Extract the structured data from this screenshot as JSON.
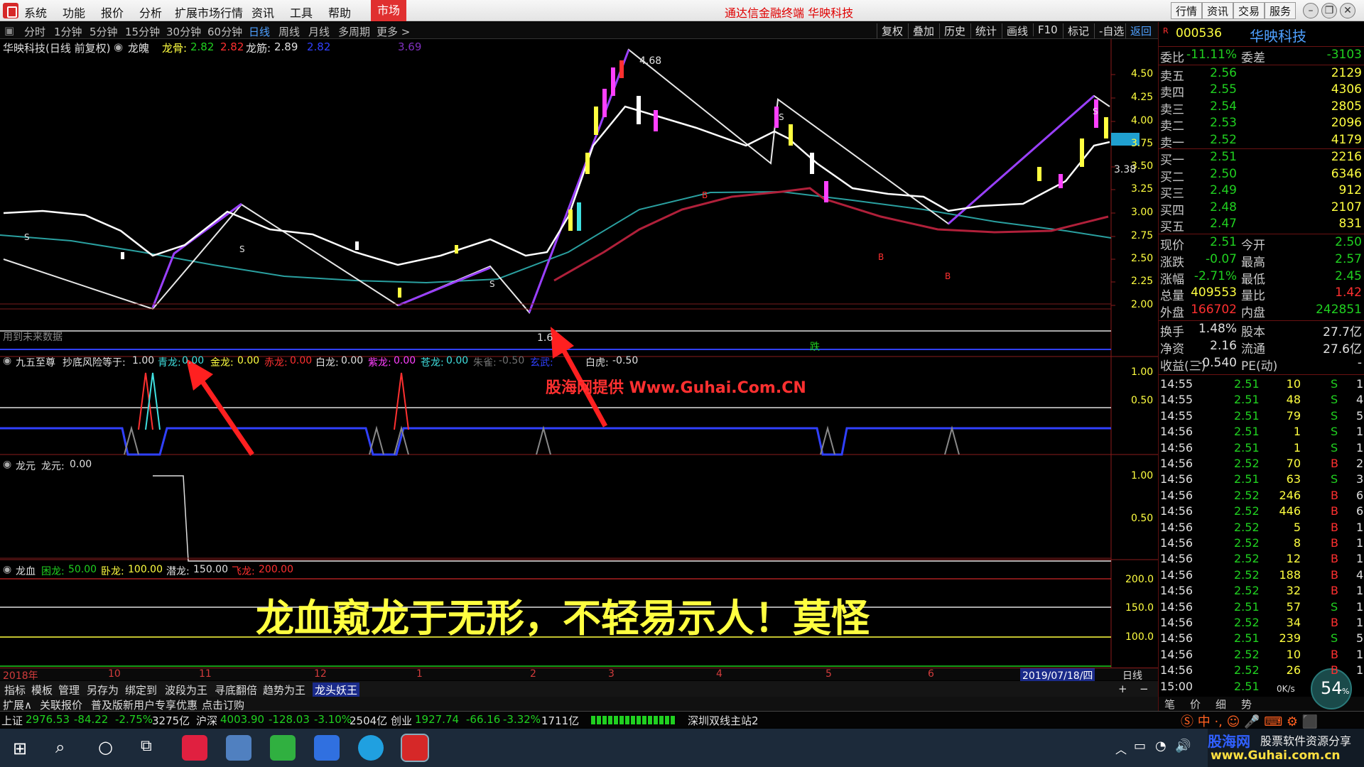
{
  "menu": {
    "items": [
      "系统",
      "功能",
      "报价",
      "分析",
      "扩展市场行情",
      "资讯",
      "工具",
      "帮助"
    ],
    "market_tab": "市场",
    "app_title": "通达信金融终端 华映科技",
    "right_buttons": [
      "行情",
      "资讯",
      "交易",
      "服务"
    ]
  },
  "toolbar": {
    "periods": [
      "分时",
      "1分钟",
      "5分钟",
      "15分钟",
      "30分钟",
      "60分钟",
      "日线",
      "周线",
      "月线",
      "多周期",
      "更多 >"
    ],
    "active_period": "日线",
    "buttons": [
      "复权",
      "叠加",
      "历史",
      "统计",
      "画线",
      "F10",
      "标记",
      "-自选",
      "返回"
    ]
  },
  "main_chart": {
    "header_stock": "华映科技(日线 前复权)",
    "indicator": "龙魄",
    "longgu_label": "龙骨:",
    "longgu_values": [
      "2.82",
      "2.82"
    ],
    "longjin_label": "龙筋:",
    "longjin_values": [
      "2.89",
      "2.82",
      "3.69"
    ],
    "price_ticks": [
      "4.50",
      "4.25",
      "4.00",
      "3.75",
      "3.50",
      "3.25",
      "3.00",
      "2.75",
      "2.50",
      "2.25",
      "2.00"
    ],
    "current_price_tag": "3.38",
    "high_label": "4.68",
    "low_label": "1.6",
    "future_note": "用到未来数据",
    "die_label": "跌",
    "s_marks": [
      "S",
      "S",
      "S",
      "S",
      "S"
    ],
    "b_marks": [
      "B",
      "B",
      "B"
    ]
  },
  "panel_jiuwu": {
    "name": "九五至尊",
    "items": [
      {
        "label": "抄底风险等于:",
        "value": "1.00",
        "color": "#e0e0e0"
      },
      {
        "label": "青龙:",
        "value": "0.00",
        "color": "#40e0e0"
      },
      {
        "label": "金龙:",
        "value": "0.00",
        "color": "#ffff40"
      },
      {
        "label": "赤龙:",
        "value": "0.00",
        "color": "#ff3030"
      },
      {
        "label": "白龙:",
        "value": "0.00",
        "color": "#e0e0e0"
      },
      {
        "label": "紫龙:",
        "value": "0.00",
        "color": "#ff40ff"
      },
      {
        "label": "苍龙:",
        "value": "0.00",
        "color": "#40e0e0"
      },
      {
        "label": "朱雀:",
        "value": "-0.50",
        "color": "#707070"
      },
      {
        "label": "玄武:",
        "value": "",
        "color": "#3040ff"
      },
      {
        "label": "白虎:",
        "value": "-0.50",
        "color": "#e0e0e0"
      }
    ],
    "ticks": [
      "1.00",
      "0.50"
    ],
    "watermark": "股海网提供 Www.Guhai.Com.CN"
  },
  "panel_longyuan": {
    "name": "龙元",
    "label": "龙元:",
    "value": "0.00",
    "ticks": [
      "1.00",
      "0.50"
    ]
  },
  "panel_longxue": {
    "name": "龙血",
    "items": [
      {
        "label": "困龙:",
        "value": "50.00",
        "color": "#20d020"
      },
      {
        "label": "卧龙:",
        "value": "100.00",
        "color": "#ffff40"
      },
      {
        "label": "潜龙:",
        "value": "150.00",
        "color": "#e0e0e0"
      },
      {
        "label": "飞龙:",
        "value": "200.00",
        "color": "#ff3030"
      }
    ],
    "ticks": [
      "200.0",
      "150.0",
      "100.0"
    ],
    "caption": "龙血窥龙于无形，不轻易示人！莫怪"
  },
  "date_axis": {
    "labels": [
      "2018年",
      "10",
      "11",
      "12",
      "1",
      "2",
      "3",
      "4",
      "5",
      "6"
    ],
    "current_date": "2019/07/18/四",
    "period": "日线"
  },
  "bottom_tabs": [
    "指标",
    "模板",
    "管理",
    "另存为",
    "绑定到",
    "波段为王",
    "寻底翻倍",
    "趋势为王",
    "龙头妖王"
  ],
  "bottom_tabs2": [
    "扩展∧",
    "关联报价",
    "普及版新用户专享优惠",
    "点击订购"
  ],
  "quote": {
    "code": "000536",
    "name": "华映科技",
    "weibi": {
      "label": "委比",
      "value": "-11.11%",
      "label2": "委差",
      "value2": "-3103"
    },
    "sells": [
      {
        "label": "卖五",
        "price": "2.56",
        "vol": "2129"
      },
      {
        "label": "卖四",
        "price": "2.55",
        "vol": "4306"
      },
      {
        "label": "卖三",
        "price": "2.54",
        "vol": "2805"
      },
      {
        "label": "卖二",
        "price": "2.53",
        "vol": "2096"
      },
      {
        "label": "卖一",
        "price": "2.52",
        "vol": "4179"
      }
    ],
    "buys": [
      {
        "label": "买一",
        "price": "2.51",
        "vol": "2216"
      },
      {
        "label": "买二",
        "price": "2.50",
        "vol": "6346"
      },
      {
        "label": "买三",
        "price": "2.49",
        "vol": "912"
      },
      {
        "label": "买四",
        "price": "2.48",
        "vol": "2107"
      },
      {
        "label": "买五",
        "price": "2.47",
        "vol": "831"
      }
    ],
    "stats": [
      {
        "k1": "现价",
        "v1": "2.51",
        "c1": "#20d020",
        "k2": "今开",
        "v2": "2.50",
        "c2": "#20d020"
      },
      {
        "k1": "涨跌",
        "v1": "-0.07",
        "c1": "#20d020",
        "k2": "最高",
        "v2": "2.57",
        "c2": "#20d020"
      },
      {
        "k1": "涨幅",
        "v1": "-2.71%",
        "c1": "#20d020",
        "k2": "最低",
        "v2": "2.45",
        "c2": "#20d020"
      },
      {
        "k1": "总量",
        "v1": "409553",
        "c1": "#ffff40",
        "k2": "量比",
        "v2": "1.42",
        "c2": "#ff3030"
      },
      {
        "k1": "外盘",
        "v1": "166702",
        "c1": "#ff3030",
        "k2": "内盘",
        "v2": "242851",
        "c2": "#20d020"
      }
    ],
    "stats2": [
      {
        "k1": "换手",
        "v1": "1.48%",
        "k2": "股本",
        "v2": "27.7亿"
      },
      {
        "k1": "净资",
        "v1": "2.16",
        "k2": "流通",
        "v2": "27.6亿"
      },
      {
        "k1": "收益(三)",
        "v1": "-0.540",
        "k2": "PE(动)",
        "v2": "-"
      }
    ],
    "ticks": [
      {
        "t": "14:55",
        "p": "2.51",
        "v": "10",
        "s": "S",
        "n": "1"
      },
      {
        "t": "14:55",
        "p": "2.51",
        "v": "48",
        "s": "S",
        "n": "4"
      },
      {
        "t": "14:55",
        "p": "2.51",
        "v": "79",
        "s": "S",
        "n": "5"
      },
      {
        "t": "14:56",
        "p": "2.51",
        "v": "1",
        "s": "S",
        "n": "1"
      },
      {
        "t": "14:56",
        "p": "2.51",
        "v": "1",
        "s": "S",
        "n": "1"
      },
      {
        "t": "14:56",
        "p": "2.52",
        "v": "70",
        "s": "B",
        "n": "2"
      },
      {
        "t": "14:56",
        "p": "2.51",
        "v": "63",
        "s": "S",
        "n": "3"
      },
      {
        "t": "14:56",
        "p": "2.52",
        "v": "246",
        "s": "B",
        "n": "6"
      },
      {
        "t": "14:56",
        "p": "2.52",
        "v": "446",
        "s": "B",
        "n": "6"
      },
      {
        "t": "14:56",
        "p": "2.52",
        "v": "5",
        "s": "B",
        "n": "1"
      },
      {
        "t": "14:56",
        "p": "2.52",
        "v": "8",
        "s": "B",
        "n": "1"
      },
      {
        "t": "14:56",
        "p": "2.52",
        "v": "12",
        "s": "B",
        "n": "1"
      },
      {
        "t": "14:56",
        "p": "2.52",
        "v": "188",
        "s": "B",
        "n": "4"
      },
      {
        "t": "14:56",
        "p": "2.52",
        "v": "32",
        "s": "B",
        "n": "1"
      },
      {
        "t": "14:56",
        "p": "2.51",
        "v": "57",
        "s": "S",
        "n": "1"
      },
      {
        "t": "14:56",
        "p": "2.52",
        "v": "34",
        "s": "B",
        "n": "1"
      },
      {
        "t": "14:56",
        "p": "2.51",
        "v": "239",
        "s": "S",
        "n": "5"
      },
      {
        "t": "14:56",
        "p": "2.52",
        "v": "10",
        "s": "B",
        "n": "1"
      },
      {
        "t": "14:56",
        "p": "2.52",
        "v": "26",
        "s": "B",
        "n": "1"
      },
      {
        "t": "15:00",
        "p": "2.51",
        "v": "",
        "s": "",
        "n": ""
      }
    ],
    "bottom_tabs": [
      "笔",
      "价",
      "细",
      "势"
    ],
    "speed": "54",
    "speed_unit": "%",
    "net_speed": "0K/s"
  },
  "status": {
    "sh": {
      "label": "上证",
      "value": "2976.53",
      "chg": "-84.22",
      "pct": "-2.75%",
      "amt": "3275亿"
    },
    "hs": {
      "label": "沪深",
      "value": "4003.90",
      "chg": "-128.03",
      "pct": "-3.10%",
      "amt": "2504亿"
    },
    "cy": {
      "label": "创业",
      "value": "1927.74",
      "chg": "-66.16",
      "pct": "-3.32%",
      "amt": "1711亿"
    },
    "station": "深圳双线主站2"
  },
  "watermark_br": {
    "site": "股海网",
    "sub": "股票软件资源分享",
    "url": "www.Guhai.com.cn"
  },
  "colors": {
    "up": "#ff3030",
    "down": "#20d020",
    "accent": "#4ea0ff",
    "menu_red": "#e03030"
  }
}
